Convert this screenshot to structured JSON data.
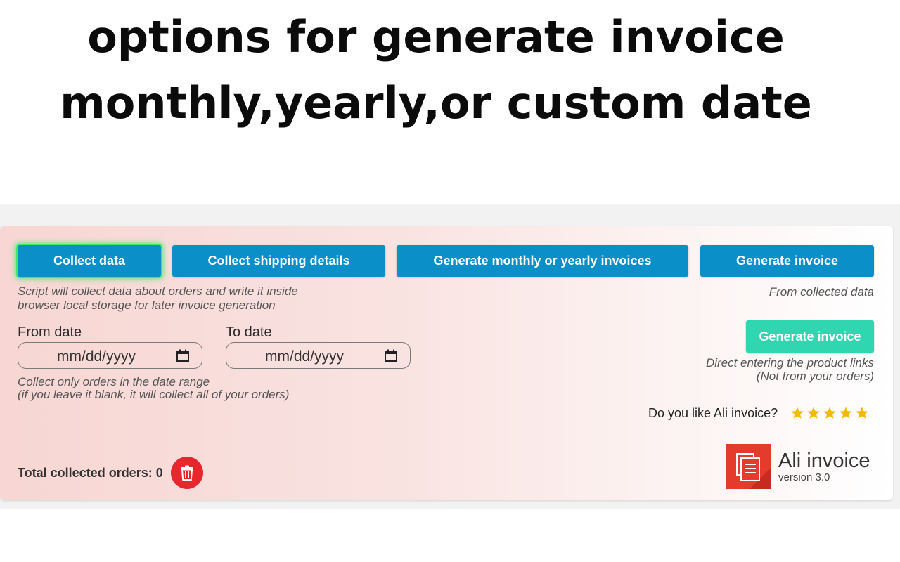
{
  "headline": {
    "line1": "options for generate invoice",
    "line2": "monthly,yearly,or custom date"
  },
  "toolbar": {
    "collect_data": "Collect data",
    "collect_shipping": "Collect shipping details",
    "generate_monthly": "Generate monthly or yearly invoices",
    "generate_invoice": "Generate invoice"
  },
  "hints": {
    "collect_line1": "Script will collect data about orders and write it inside",
    "collect_line2": "browser local storage for later invoice generation",
    "from_collected": "From collected data",
    "direct_line1": "Direct entering the product links",
    "direct_line2": "(Not from your orders)",
    "range_line1": "Collect only orders in the date range",
    "range_line2": "(if you leave it blank, it will collect all of your orders)"
  },
  "dates": {
    "from_label": "From date",
    "to_label": "To date",
    "from_value": "mm/dd/yyyy",
    "to_value": "mm/dd/yyyy"
  },
  "direct": {
    "button_label": "Generate invoice"
  },
  "rating": {
    "question": "Do you like Ali invoice?",
    "stars": 5,
    "star_color": "#f5b800"
  },
  "footer": {
    "total_label": "Total collected orders: 0"
  },
  "brand": {
    "name": "Ali invoice",
    "version": "version 3.0",
    "logo_color": "#e53b2d"
  },
  "colors": {
    "primary_button": "#0a8fc9",
    "teal_button": "#2fd6b0",
    "trash_button": "#e8262e"
  }
}
